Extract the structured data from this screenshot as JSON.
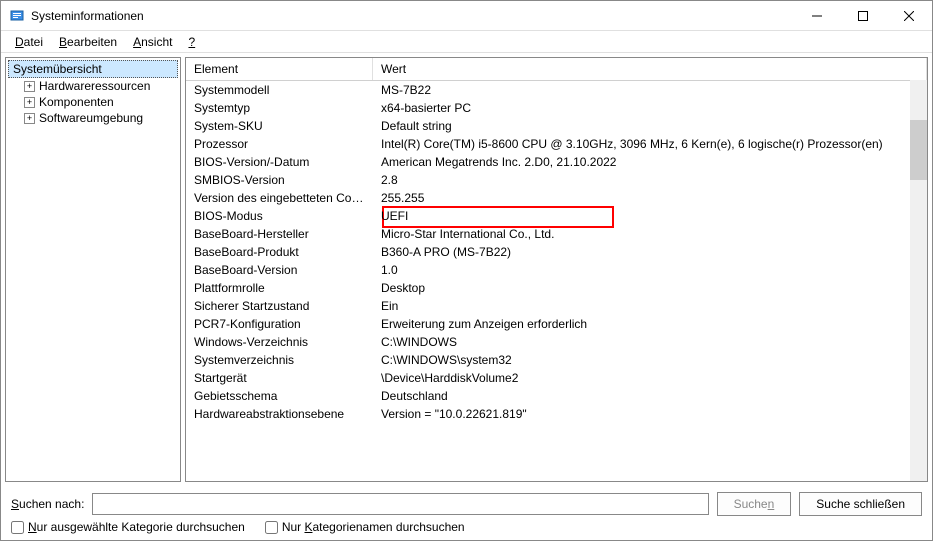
{
  "window": {
    "title": "Systeminformationen"
  },
  "menu": {
    "file": "Datei",
    "edit": "Bearbeiten",
    "view": "Ansicht",
    "help": "?"
  },
  "tree": {
    "root": "Systemübersicht",
    "items": [
      {
        "label": "Hardwareressourcen"
      },
      {
        "label": "Komponenten"
      },
      {
        "label": "Softwareumgebung"
      }
    ]
  },
  "list": {
    "header_element": "Element",
    "header_value": "Wert",
    "rows": [
      {
        "el": "Systemmodell",
        "wert": "MS-7B22",
        "hl": false
      },
      {
        "el": "Systemtyp",
        "wert": "x64-basierter PC",
        "hl": false
      },
      {
        "el": "System-SKU",
        "wert": "Default string",
        "hl": false
      },
      {
        "el": "Prozessor",
        "wert": "Intel(R) Core(TM) i5-8600 CPU @ 3.10GHz, 3096 MHz, 6 Kern(e), 6 logische(r) Prozessor(en)",
        "hl": false
      },
      {
        "el": "BIOS-Version/-Datum",
        "wert": "American Megatrends Inc. 2.D0, 21.10.2022",
        "hl": false
      },
      {
        "el": "SMBIOS-Version",
        "wert": "2.8",
        "hl": false
      },
      {
        "el": "Version des eingebetteten Cont...",
        "wert": "255.255",
        "hl": false
      },
      {
        "el": "BIOS-Modus",
        "wert": "UEFI",
        "hl": true
      },
      {
        "el": "BaseBoard-Hersteller",
        "wert": "Micro-Star International Co., Ltd.",
        "hl": false
      },
      {
        "el": "BaseBoard-Produkt",
        "wert": "B360-A PRO (MS-7B22)",
        "hl": false
      },
      {
        "el": "BaseBoard-Version",
        "wert": "1.0",
        "hl": false
      },
      {
        "el": "Plattformrolle",
        "wert": "Desktop",
        "hl": false
      },
      {
        "el": "Sicherer Startzustand",
        "wert": "Ein",
        "hl": false
      },
      {
        "el": "PCR7-Konfiguration",
        "wert": "Erweiterung zum Anzeigen erforderlich",
        "hl": false
      },
      {
        "el": "Windows-Verzeichnis",
        "wert": "C:\\WINDOWS",
        "hl": false
      },
      {
        "el": "Systemverzeichnis",
        "wert": "C:\\WINDOWS\\system32",
        "hl": false
      },
      {
        "el": "Startgerät",
        "wert": "\\Device\\HarddiskVolume2",
        "hl": false
      },
      {
        "el": "Gebietsschema",
        "wert": "Deutschland",
        "hl": false
      },
      {
        "el": "Hardwareabstraktionsebene",
        "wert": "Version = \"10.0.22621.819\"",
        "hl": false
      }
    ]
  },
  "search": {
    "label": "Suchen nach:",
    "btn_search": "Suchen",
    "btn_close": "Suche schließen",
    "chk_selected": "Nur ausgewählte Kategorie durchsuchen",
    "chk_names": "Nur Kategorienamen durchsuchen"
  }
}
